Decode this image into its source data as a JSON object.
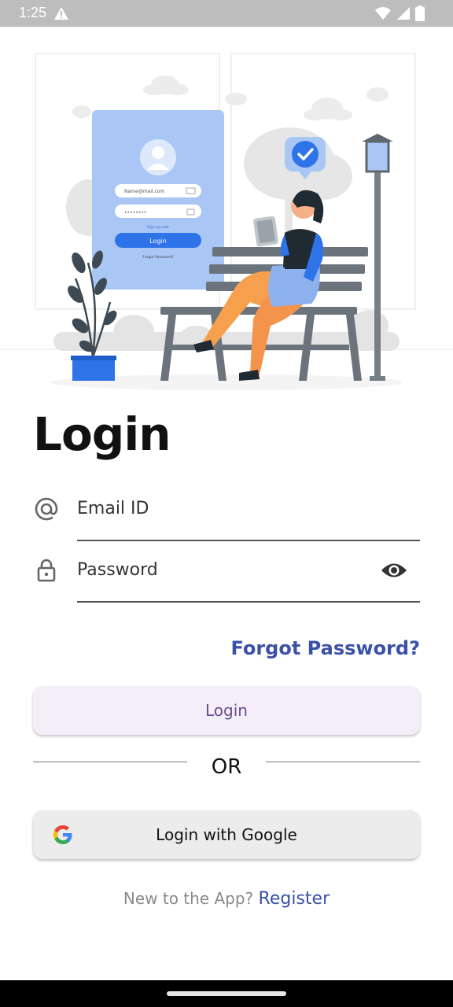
{
  "status_bar": {
    "time": "1:25"
  },
  "login": {
    "title": "Login",
    "email_placeholder": "Email ID",
    "password_placeholder": "Password",
    "forgot": "Forgot Password?",
    "login_button": "Login",
    "or": "OR",
    "google_button": "Login with Google",
    "new_prompt": "New to the App?",
    "register_link": "Register"
  },
  "illustration": {
    "email_hint": "Name@mail.com",
    "password_hint": "••••••••",
    "signup_hint": "Sign up now",
    "button_hint": "Login",
    "forgot_hint": "Forgot Password?"
  },
  "colors": {
    "brand": "#3b51a8",
    "login_button_bg": "#f3eef8",
    "google_button_bg": "#ececec"
  },
  "icons": [
    "warning-icon",
    "wifi-icon",
    "signal-icon",
    "battery-icon",
    "at-icon",
    "lock-icon",
    "eye-icon",
    "google-icon"
  ]
}
